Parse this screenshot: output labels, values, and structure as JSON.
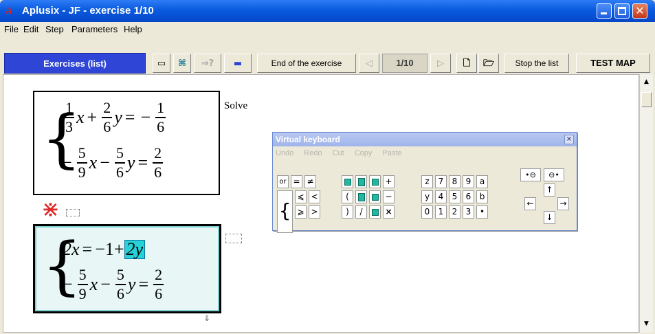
{
  "window": {
    "title": "Aplusix - JF - exercise 1/10",
    "icon": "A"
  },
  "menu": {
    "items": [
      "File",
      "Edit",
      "Step",
      "Parameters",
      "Help"
    ]
  },
  "toolbar": {
    "exercises_label": "Exercises (list)",
    "end_label": "End of the exercise",
    "page_label": "1/10",
    "stop_label": "Stop the list",
    "testmap_label": "TEST MAP"
  },
  "solve_label": "Solve",
  "step_symbol": "⋇",
  "keyboard": {
    "title": "Virtual keyboard",
    "close": "×",
    "menu": [
      "Undo",
      "Redo",
      "Cut",
      "Copy",
      "Paste"
    ],
    "keys": {
      "or": "or",
      "eq": "=",
      "neq": "≠",
      "plus": "+",
      "le": "⩽",
      "lt": "<",
      "lparen": "(",
      "minus": "−",
      "ge": "⩾",
      "gt": ">",
      "rparen": ")",
      "slash": "/",
      "times": "×",
      "brace": "{",
      "z": "z",
      "seven": "7",
      "eight": "8",
      "nine": "9",
      "a": "a",
      "y": "y",
      "four": "4",
      "five": "5",
      "six": "6",
      "b": "b",
      "zero": "0",
      "one": "1",
      "two": "2",
      "three": "3",
      "dot": "•",
      "nav1": "•⊖",
      "nav2": "⊖•",
      "up": "↑",
      "left": "←",
      "right": "→",
      "down": "↓"
    }
  },
  "equations": {
    "box1_row1": {
      "n1": "1",
      "d1": "3",
      "v1": "x",
      "op1": "+",
      "n2": "2",
      "d2": "6",
      "v2": "y",
      "eq": "=",
      "sign": "−",
      "n3": "1",
      "d3": "6"
    },
    "box1_row2": {
      "s0": "−",
      "n1": "5",
      "d1": "9",
      "v1": "x",
      "op1": "−",
      "n2": "5",
      "d2": "6",
      "v2": "y",
      "eq": "=",
      "n3": "2",
      "d3": "6"
    },
    "box2_row1": {
      "lhs": "2x",
      "eq": "=",
      "rhs": "−1+",
      "hl": "2y"
    },
    "box2_row2": {
      "s0": "−",
      "n1": "5",
      "d1": "9",
      "v1": "x",
      "op1": "−",
      "n2": "5",
      "d2": "6",
      "v2": "y",
      "eq": "=",
      "n3": "2",
      "d3": "6"
    }
  }
}
